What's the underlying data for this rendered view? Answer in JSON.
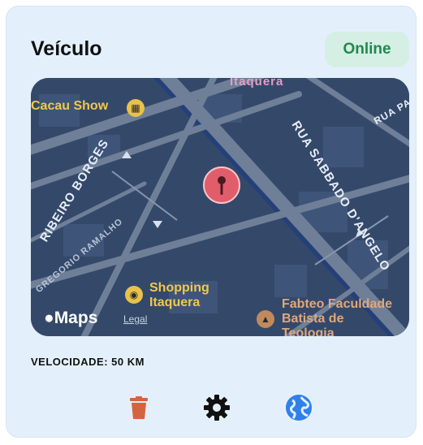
{
  "card": {
    "title": "Veículo",
    "status": "Online",
    "speed_label": "VELOCIDADE: 50 KM"
  },
  "map": {
    "labels": {
      "top_street": "Itaquera",
      "cacau_show": "Cacau Show",
      "rua_sabbado": "RUA SABBADO D'ANGELO",
      "rua_right": "RUA PAU",
      "rua_left": "RIBEIRO BORGES",
      "rua_ramalho": "GREGORIO RAMALHO",
      "shopping_line1": "Shopping",
      "shopping_line2": "Itaquera",
      "fateo_line1": "Fabteo Faculdade",
      "fateo_line2": "Batista de",
      "fateo_line3": "Teologia"
    },
    "attribution": "Maps",
    "legal": "Legal"
  },
  "actions": {
    "delete": "trash-icon",
    "settings": "gear-icon",
    "web": "globe-icon"
  },
  "colors": {
    "status_bg": "#d5efe4",
    "status_text": "#1f8a4c",
    "trash": "#d4643d",
    "globe": "#2f80e8",
    "pin": "#e25d6b"
  }
}
